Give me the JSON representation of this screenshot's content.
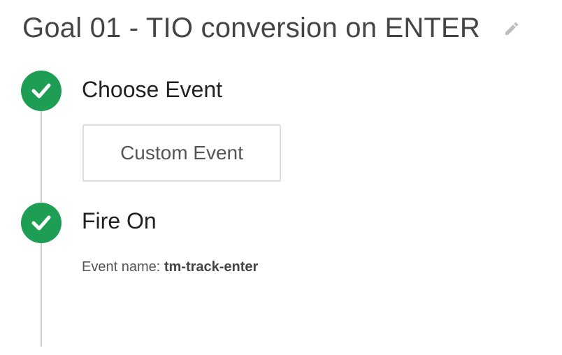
{
  "goal": {
    "title": "Goal 01 - TIO conversion on ENTER",
    "edit_icon": "pencil-icon"
  },
  "steps": [
    {
      "label": "Choose Event",
      "status": "complete",
      "icon": "checkmark-icon",
      "selected_event": "Custom Event"
    },
    {
      "label": "Fire On",
      "status": "complete",
      "icon": "checkmark-icon",
      "event_name_label": "Event name:",
      "event_name_value": "tm-track-enter"
    }
  ],
  "colors": {
    "complete": "#1e9e55",
    "connector": "#cccccc",
    "title": "#444444"
  }
}
